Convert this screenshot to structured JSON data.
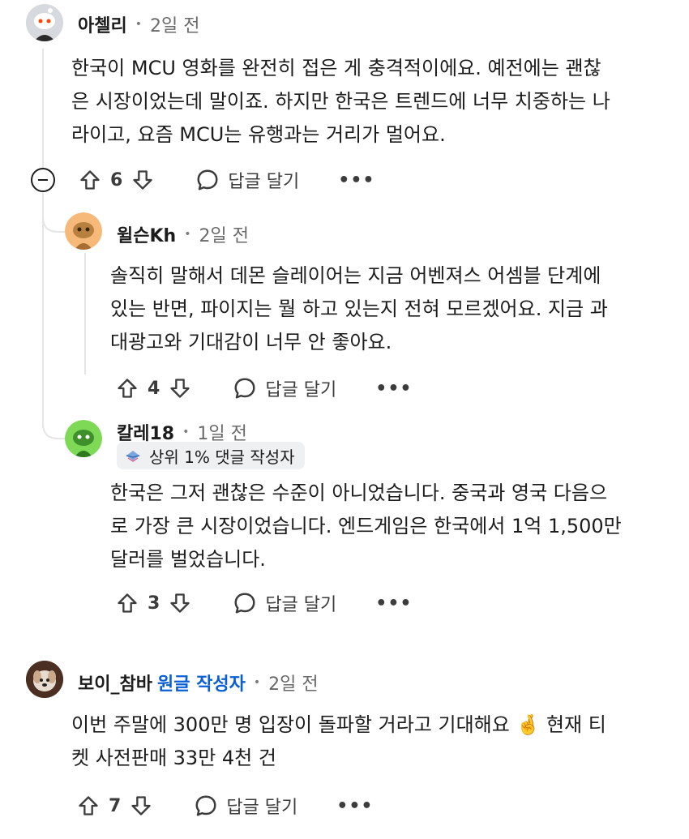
{
  "comments": [
    {
      "author": "아첼리",
      "time": "2일 전",
      "lines": [
        "한국이 MCU 영화를 완전히 접은 게 충격적이에요. 예전에는 괜찮",
        "은 시장이었는데 말이죠. 하지만 한국은 트렌드에 너무 치중하는 나",
        "라이고, 요즘 MCU는 유행과는 거리가 멀어요."
      ],
      "votes": "6",
      "reply": "답글 달기",
      "more": "•••"
    },
    {
      "author": "윌슨Kh",
      "time": "2일 전",
      "lines": [
        "솔직히 말해서 데몬 슬레이어는 지금 어벤져스 어셈블 단계에",
        "있는 반면, 파이지는 뭘 하고 있는지 전혀 모르겠어요. 지금 과",
        "대광고와 기대감이 너무 안 좋아요."
      ],
      "votes": "4",
      "reply": "답글 달기",
      "more": "•••"
    },
    {
      "author": "칼레18",
      "time": "1일 전",
      "badge": "상위 1% 댓글 작성자",
      "lines": [
        "한국은 그저 괜찮은 수준이 아니었습니다. 중국과 영국 다음으",
        "로 가장 큰 시장이었습니다. 엔드게임은 한국에서 1억 1,500만",
        "달러를 벌었습니다."
      ],
      "votes": "3",
      "reply": "답글 달기",
      "more": "•••"
    },
    {
      "author": "보이_참바",
      "op_label": "원글 작성자",
      "time": "2일 전",
      "lines": [
        "이번 주말에 300만 명 입장이 돌파할 거라고 기대해요 🤞 현재 티",
        "켓 사전판매 33만 4천 건"
      ],
      "votes": "7",
      "reply": "답글 달기",
      "more": "•••"
    }
  ],
  "separator": "•"
}
